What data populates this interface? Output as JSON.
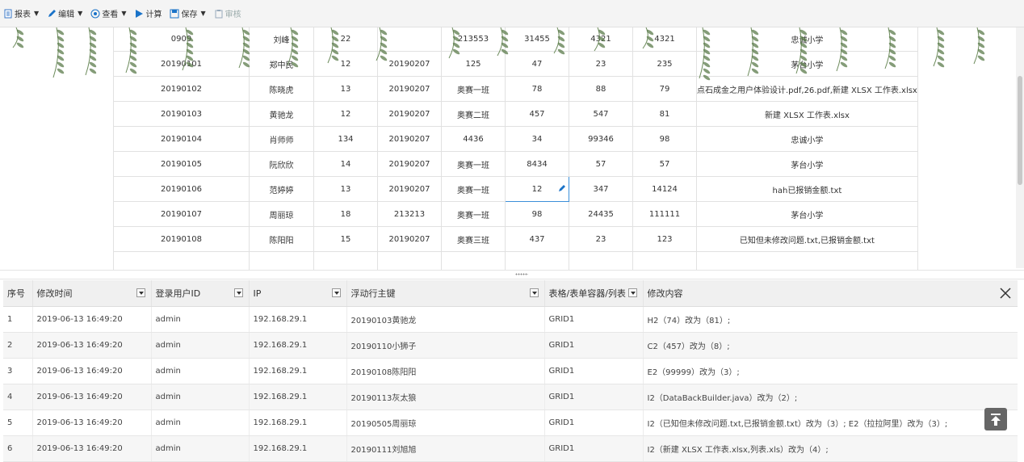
{
  "toolbar": {
    "items": [
      {
        "label": "报表",
        "icon": "report-icon"
      },
      {
        "label": "编辑",
        "icon": "pencil-icon"
      },
      {
        "label": "查看",
        "icon": "view-icon"
      },
      {
        "label": "计算",
        "icon": "play-icon"
      },
      {
        "label": "保存",
        "icon": "save-icon"
      },
      {
        "label": "审核",
        "icon": "audit-icon"
      }
    ]
  },
  "report": {
    "rows": [
      [
        "0909",
        "刘峰",
        "22",
        "",
        "213553",
        "31455",
        "4321",
        "4321",
        "忠诚小学"
      ],
      [
        "20190101",
        "郑中民",
        "12",
        "20190207",
        "125",
        "47",
        "23",
        "235",
        "茅台小学"
      ],
      [
        "20190102",
        "陈晓虎",
        "13",
        "20190207",
        "奥赛一班",
        "78",
        "88",
        "79",
        "点石成金之用户体验设计.pdf,26.pdf,新建 XLSX 工作表.xlsx"
      ],
      [
        "20190103",
        "黄驰龙",
        "12",
        "20190207",
        "奥赛二班",
        "457",
        "547",
        "81",
        "新建 XLSX 工作表.xlsx"
      ],
      [
        "20190104",
        "肖师师",
        "134",
        "20190207",
        "4436",
        "34",
        "99346",
        "98",
        "忠诚小学"
      ],
      [
        "20190105",
        "阮欣欣",
        "14",
        "20190207",
        "奥赛一班",
        "8434",
        "57",
        "57",
        "茅台小学"
      ],
      [
        "20190106",
        "范婷婷",
        "13",
        "20190207",
        "奥赛一班",
        "12",
        "347",
        "14124",
        "hah已报销金额.txt"
      ],
      [
        "20190107",
        "周丽琼",
        "18",
        "213213",
        "奥赛一班",
        "98",
        "24435",
        "111111",
        "茅台小学"
      ],
      [
        "20190108",
        "陈阳阳",
        "15",
        "20190207",
        "奥赛三班",
        "437",
        "23",
        "123",
        "已知但未修改问题.txt,已报销金额.txt"
      ],
      [
        "",
        "",
        "",
        "",
        "",
        "",
        "",
        "",
        ""
      ]
    ]
  },
  "log": {
    "headers": [
      "序号",
      "修改时间",
      "登录用户ID",
      "IP",
      "浮动行主键",
      "表格/表单容器/列表",
      "修改内容"
    ],
    "rows": [
      [
        "1",
        "2019-06-13 16:49:20",
        "admin",
        "192.168.29.1",
        "20190103黄驰龙",
        "GRID1",
        "H2（74）改为（81）;"
      ],
      [
        "2",
        "2019-06-13 16:49:20",
        "admin",
        "192.168.29.1",
        "20190110小狮子",
        "GRID1",
        "C2（457）改为（8）;"
      ],
      [
        "3",
        "2019-06-13 16:49:20",
        "admin",
        "192.168.29.1",
        "20190108陈阳阳",
        "GRID1",
        "E2（99999）改为（3）;"
      ],
      [
        "4",
        "2019-06-13 16:49:20",
        "admin",
        "192.168.29.1",
        "20190113灰太狼",
        "GRID1",
        "I2（DataBackBuilder.java）改为（2）;"
      ],
      [
        "5",
        "2019-06-13 16:49:20",
        "admin",
        "192.168.29.1",
        "20190505周丽琼",
        "GRID1",
        "I2（已知但未修改问题.txt,已报销金额.txt）改为（3）; E2（拉拉阿里）改为（3）;"
      ],
      [
        "6",
        "2019-06-13 16:49:20",
        "admin",
        "192.168.29.1",
        "20190111刘旭旭",
        "GRID1",
        "I2（新建 XLSX 工作表.xlsx,列表.xls）改为（4）;"
      ]
    ]
  },
  "colors": {
    "accent": "#1a73c8",
    "selected_border": "#3b8fd9",
    "leaf": "#5c7c4c"
  }
}
